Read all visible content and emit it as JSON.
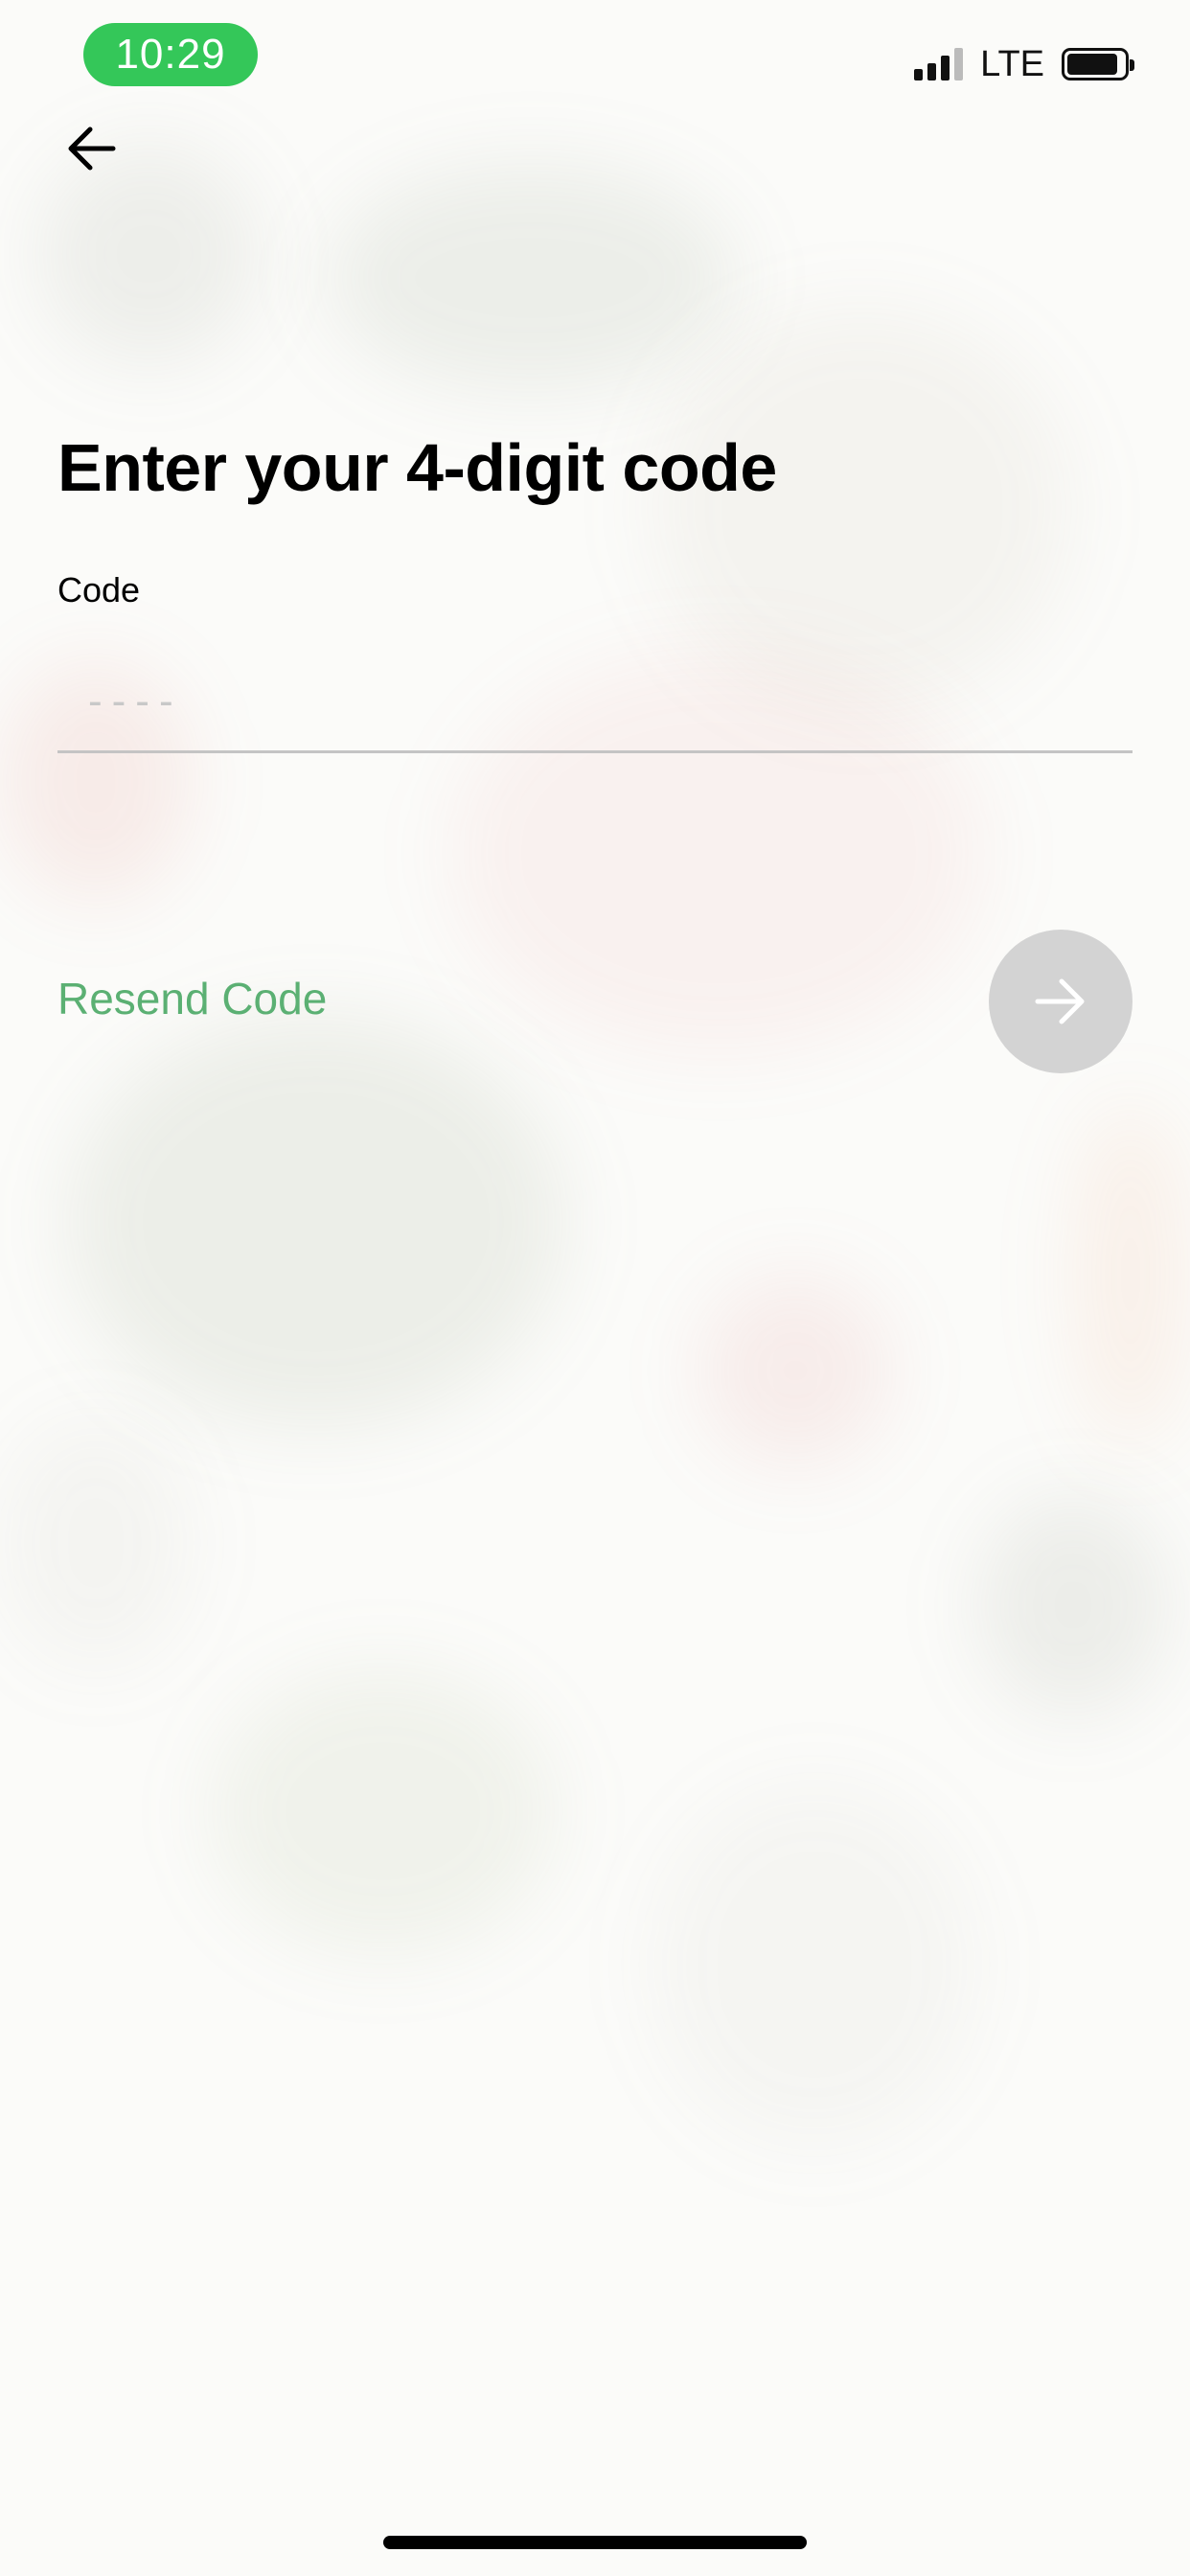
{
  "status_bar": {
    "time": "10:29",
    "network": "LTE",
    "battery_level": 0.9,
    "time_pill_color": "#34c759"
  },
  "nav": {
    "back_icon": "arrow-left-icon"
  },
  "main": {
    "title": "Enter your 4-digit code",
    "code_label": "Code",
    "code_value": "",
    "code_placeholder": "----",
    "resend_label": "Resend Code",
    "next_icon": "arrow-right-icon"
  },
  "colors": {
    "accent_green": "#5bb073",
    "next_button_disabled": "#d3d3d3"
  }
}
